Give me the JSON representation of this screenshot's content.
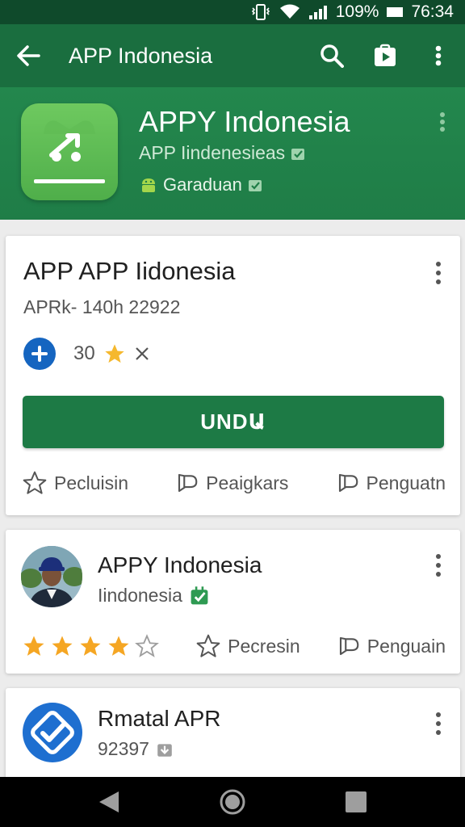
{
  "status_bar": {
    "battery": "109%",
    "time": "76:34"
  },
  "toolbar": {
    "title": "APP Indonesia"
  },
  "header": {
    "app_name": "APPY Indonesia",
    "subtitle": "APP Iindenesieas",
    "category": "Garaduan"
  },
  "card1": {
    "title": "APP APP Iidonesia",
    "subtitle": "APRk- 140h 22922",
    "rating_value": "30",
    "install_label": "UNDԱ",
    "actions": [
      "Pecluisin",
      "Peaigkars",
      "Penguatn"
    ]
  },
  "card2": {
    "title": "APPY Indonesia",
    "subtitle": "Iindonesia",
    "rating": 4,
    "rating_max": 5,
    "actions": [
      "Pecresin",
      "Penguain"
    ]
  },
  "card3": {
    "title": "Rmatal APR",
    "subtitle": "92397"
  },
  "colors": {
    "status_bar": "#0f4a2b",
    "toolbar": "#1a6e3f",
    "header": "#23874d",
    "install_button": "#1d7a45",
    "star": "#f5a623",
    "plus_button": "#1565c0"
  }
}
